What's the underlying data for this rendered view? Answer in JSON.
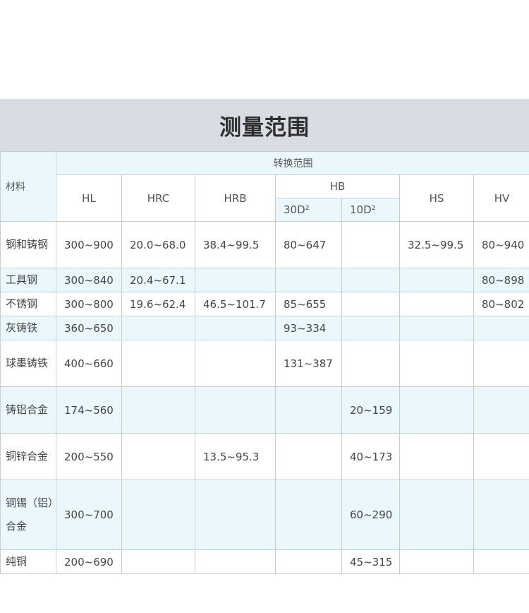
{
  "title": "测量范围",
  "header": {
    "material": "材料",
    "conversion_range": "转换范围",
    "hl": "HL",
    "hrc": "HRC",
    "hrb": "HRB",
    "hb": "HB",
    "hb_30d2": "30D²",
    "hb_10d2": "10D²",
    "hs": "HS",
    "hv": "HV"
  },
  "rows": [
    {
      "material": "钢和铸钢",
      "hl": "300~900",
      "hrc": "20.0~68.0",
      "hrb": "38.4~99.5",
      "hb30": "80~647",
      "hb10": "",
      "hs": "32.5~99.5",
      "hv": "80~940"
    },
    {
      "material": "工具钢",
      "hl": "300~840",
      "hrc": "20.4~67.1",
      "hrb": "",
      "hb30": "",
      "hb10": "",
      "hs": "",
      "hv": "80~898"
    },
    {
      "material": "不锈钢",
      "hl": "300~800",
      "hrc": "19.6~62.4",
      "hrb": "46.5~101.7",
      "hb30": "85~655",
      "hb10": "",
      "hs": "",
      "hv": "80~802"
    },
    {
      "material": "灰铸铁",
      "hl": "360~650",
      "hrc": "",
      "hrb": "",
      "hb30": "93~334",
      "hb10": "",
      "hs": "",
      "hv": ""
    },
    {
      "material": "球墨铸铁",
      "hl": "400~660",
      "hrc": "",
      "hrb": "",
      "hb30": "131~387",
      "hb10": "",
      "hs": "",
      "hv": ""
    },
    {
      "material": "铸铝合金",
      "hl": "174~560",
      "hrc": "",
      "hrb": "",
      "hb30": "",
      "hb10": "20~159",
      "hs": "",
      "hv": ""
    },
    {
      "material": "铜锌合金",
      "hl": "200~550",
      "hrc": "",
      "hrb": "13.5~95.3",
      "hb30": "",
      "hb10": "40~173",
      "hs": "",
      "hv": ""
    },
    {
      "material": "铜锡（铝）合金",
      "hl": "300~700",
      "hrc": "",
      "hrb": "",
      "hb30": "",
      "hb10": "60~290",
      "hs": "",
      "hv": ""
    },
    {
      "material": "纯铜",
      "hl": "200~690",
      "hrc": "",
      "hrb": "",
      "hb30": "",
      "hb10": "45~315",
      "hs": "",
      "hv": ""
    }
  ]
}
